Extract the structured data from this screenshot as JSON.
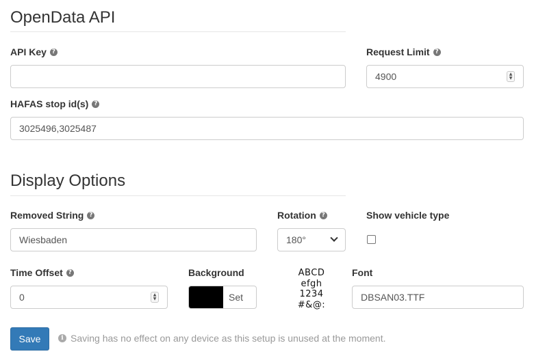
{
  "opendata": {
    "title": "OpenData API",
    "api_key": {
      "label": "API Key",
      "value": "",
      "placeholder": ""
    },
    "request_limit": {
      "label": "Request Limit",
      "value": "4900"
    },
    "hafas": {
      "label": "HAFAS stop id(s)",
      "value": "3025496,3025487"
    }
  },
  "display": {
    "title": "Display Options",
    "removed_string": {
      "label": "Removed String",
      "value": "Wiesbaden"
    },
    "rotation": {
      "label": "Rotation",
      "selected": "180°"
    },
    "vehicle_type": {
      "label": "Show vehicle type",
      "checked": false
    },
    "time_offset": {
      "label": "Time Offset",
      "value": "0"
    },
    "background": {
      "label": "Background",
      "color": "#000000",
      "button_label": "Set"
    },
    "font_preview": {
      "line1": "ABCD",
      "line2": "efgh",
      "line3": "1234",
      "line4": "#&@:"
    },
    "font": {
      "label": "Font",
      "value": "DBSAN03.TTF"
    }
  },
  "footer": {
    "save_label": "Save",
    "note": "Saving has no effect on any device as this setup is unused at the moment."
  },
  "icons": {
    "help": "question-circle-icon",
    "info": "info-circle-icon",
    "spinner": "number-spinner-icon",
    "dropdown": "chevron-down-icon"
  },
  "colors": {
    "primary": "#337ab7",
    "border": "#cccccc",
    "muted_text": "#999999"
  }
}
